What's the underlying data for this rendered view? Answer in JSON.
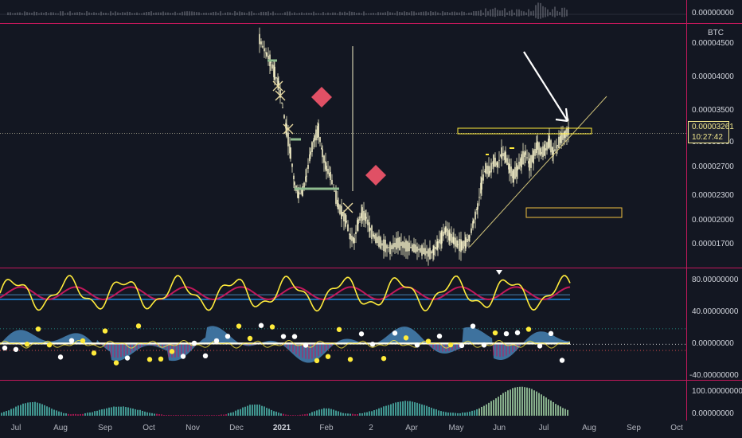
{
  "chart_data": {
    "type": "line",
    "symbol_scale_label": "BTC",
    "x_tick_labels": [
      "Jul",
      "Aug",
      "Sep",
      "Oct",
      "Nov",
      "Dec",
      "2021",
      "Feb",
      "2",
      "Apr",
      "May",
      "Jun",
      "Jul",
      "Aug",
      "Sep",
      "Oct"
    ],
    "volume_scale_label": "0.00000000",
    "price_scale_labels": [
      "0.00004500",
      "0.00004000",
      "0.00003500",
      "0.00003000",
      "0.00002700",
      "0.00002300",
      "0.00002000",
      "0.00001700"
    ],
    "price_axis": [
      1.6e-05,
      4.7e-05
    ],
    "last_price_label": "0.00003261",
    "countdown_label": "10:27:42",
    "price_series": {
      "x": [
        326,
        330,
        335,
        340,
        345,
        350,
        355,
        360,
        365,
        370,
        375,
        380,
        385,
        390,
        395,
        400,
        405,
        410,
        415,
        420,
        425,
        430,
        435,
        440,
        445,
        450,
        455,
        460,
        465,
        470,
        480,
        490,
        500,
        510,
        520,
        530,
        540,
        545,
        550,
        555,
        560,
        565,
        570,
        575,
        580,
        585,
        590,
        595,
        600,
        605,
        610,
        615,
        620,
        625,
        630,
        635,
        640,
        645,
        650,
        655,
        660,
        665,
        670,
        675,
        680,
        685,
        690,
        695,
        700,
        705,
        710,
        715
      ],
      "y": [
        4.5e-05,
        4.4e-05,
        4.3e-05,
        4.2e-05,
        4.05e-05,
        3.9e-05,
        3.6e-05,
        3.3e-05,
        3e-05,
        2.6e-05,
        2.45e-05,
        2.5e-05,
        2.7e-05,
        3e-05,
        3.2e-05,
        3.3e-05,
        3e-05,
        2.8e-05,
        2.7e-05,
        2.5e-05,
        2.3e-05,
        2.2e-05,
        2.1e-05,
        1.9e-05,
        1.85e-05,
        2.1e-05,
        2.2e-05,
        2.15e-05,
        2e-05,
        1.9e-05,
        1.8e-05,
        1.75e-05,
        1.82e-05,
        1.78e-05,
        1.75e-05,
        1.72e-05,
        1.68e-05,
        1.72e-05,
        1.8e-05,
        1.9e-05,
        2e-05,
        1.9e-05,
        1.85e-05,
        1.8e-05,
        1.78e-05,
        1.82e-05,
        1.9e-05,
        2.1e-05,
        2.3e-05,
        2.6e-05,
        2.8e-05,
        2.75e-05,
        2.9e-05,
        2.85e-05,
        3e-05,
        2.95e-05,
        2.8e-05,
        2.7e-05,
        2.8e-05,
        2.9e-05,
        3e-05,
        2.85e-05,
        2.95e-05,
        3.1e-05,
        3e-05,
        3.05e-05,
        3.15e-05,
        3e-05,
        3.1e-05,
        3.2e-05,
        3.25e-05,
        3.3e-05
      ]
    },
    "oscillator_scale_labels": [
      "80.00000000",
      "40.00000000",
      "0.00000000",
      "-40.00000000"
    ],
    "oscillator_axis": [
      -45,
      95
    ],
    "lower_scale_labels": [
      "100.00000000",
      "0.00000000"
    ],
    "colors": {
      "price": "#f5f0c8",
      "yellow": "#ffeb3b",
      "magenta": "#c2185b",
      "red": "#ef5350",
      "blue": "#2196f3",
      "steel": "#4682b4",
      "teal": "#4db6ac",
      "white": "#ffffff",
      "diamond": "#e05065",
      "trend": "#cfc27a"
    }
  }
}
